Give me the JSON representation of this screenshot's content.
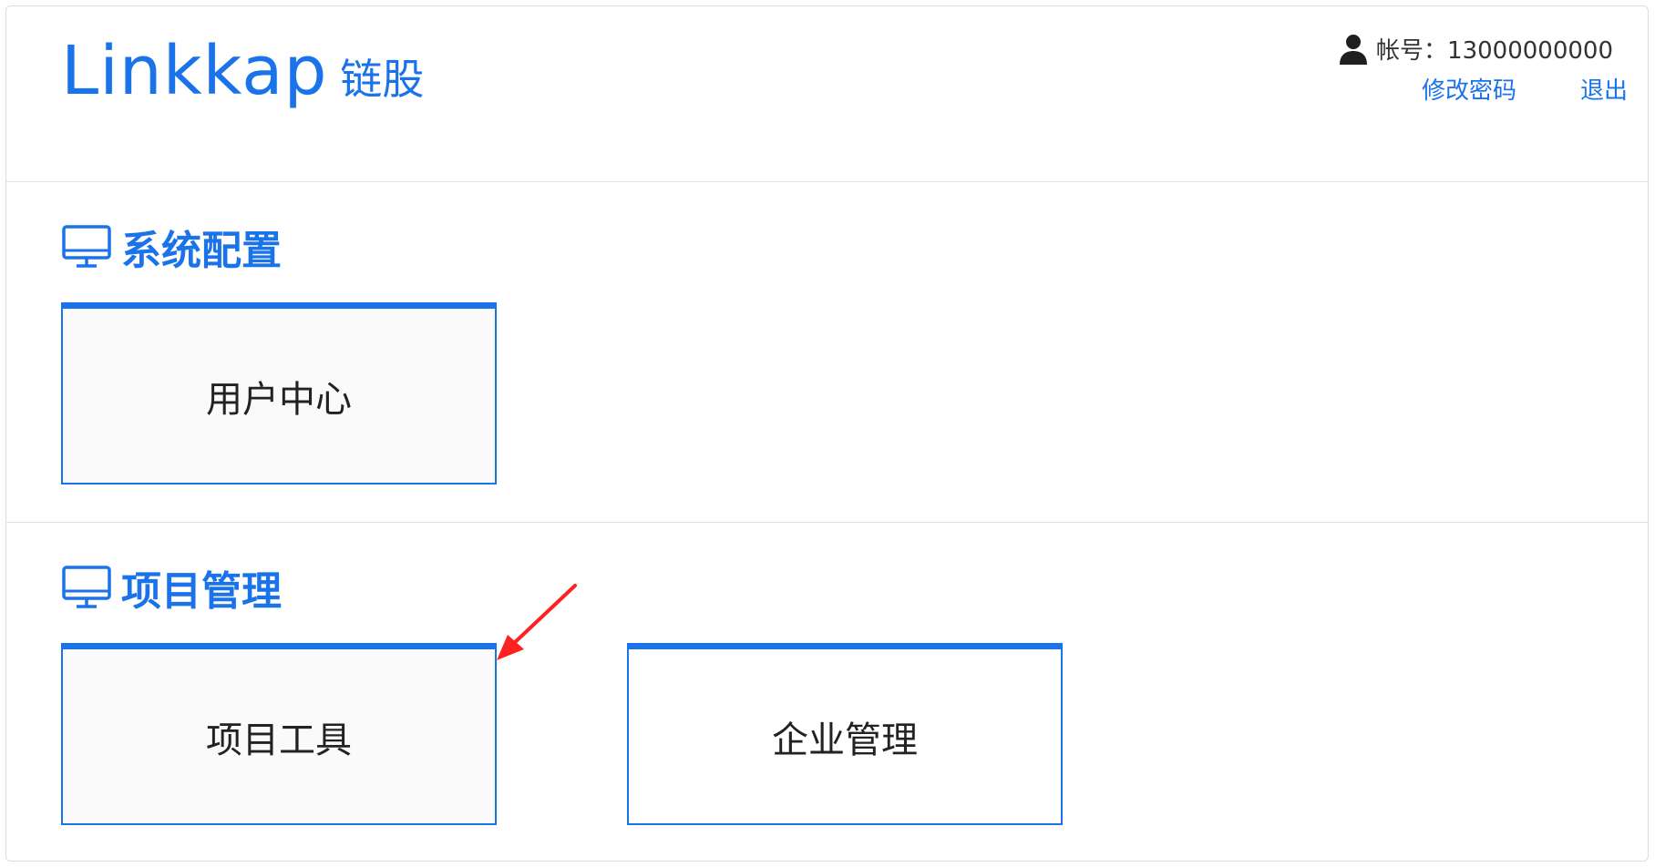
{
  "header": {
    "logo_text": "Linkkap",
    "logo_cn": "链股",
    "account_label": "帐号：13000000000",
    "change_password": "修改密码",
    "logout": "退出"
  },
  "sections": [
    {
      "title": "系统配置",
      "cards": [
        "用户中心"
      ]
    },
    {
      "title": "项目管理",
      "cards": [
        "项目工具",
        "企业管理"
      ]
    }
  ],
  "icons": {
    "user": "user-icon",
    "section": "monitor-icon",
    "annotation": "red-arrow-icon"
  },
  "colors": {
    "accent": "#1a73e8",
    "annotation": "#ff2020"
  }
}
